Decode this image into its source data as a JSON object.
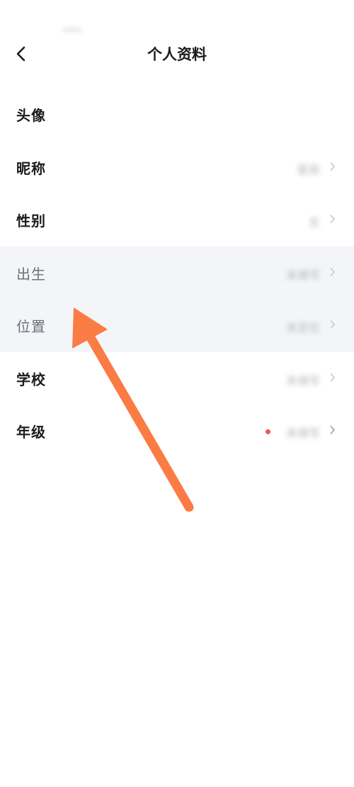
{
  "header": {
    "title": "个人资料"
  },
  "rows": [
    {
      "label": "头像",
      "value": ""
    },
    {
      "label": "昵称",
      "value": "星辰"
    },
    {
      "label": "性别",
      "value": "女"
    },
    {
      "label": "出生",
      "value": "未填写"
    },
    {
      "label": "位置",
      "value": "未定位"
    },
    {
      "label": "学校",
      "value": "未填写"
    },
    {
      "label": "年级",
      "value": "未填写"
    }
  ],
  "colors": {
    "annotation_arrow": "#fb7b45",
    "highlight_bg": "#f4f5f8",
    "badge_dot": "#f2545b"
  },
  "icons": {
    "back": "chevron-left-icon",
    "row_arrow": "chevron-right-icon"
  }
}
